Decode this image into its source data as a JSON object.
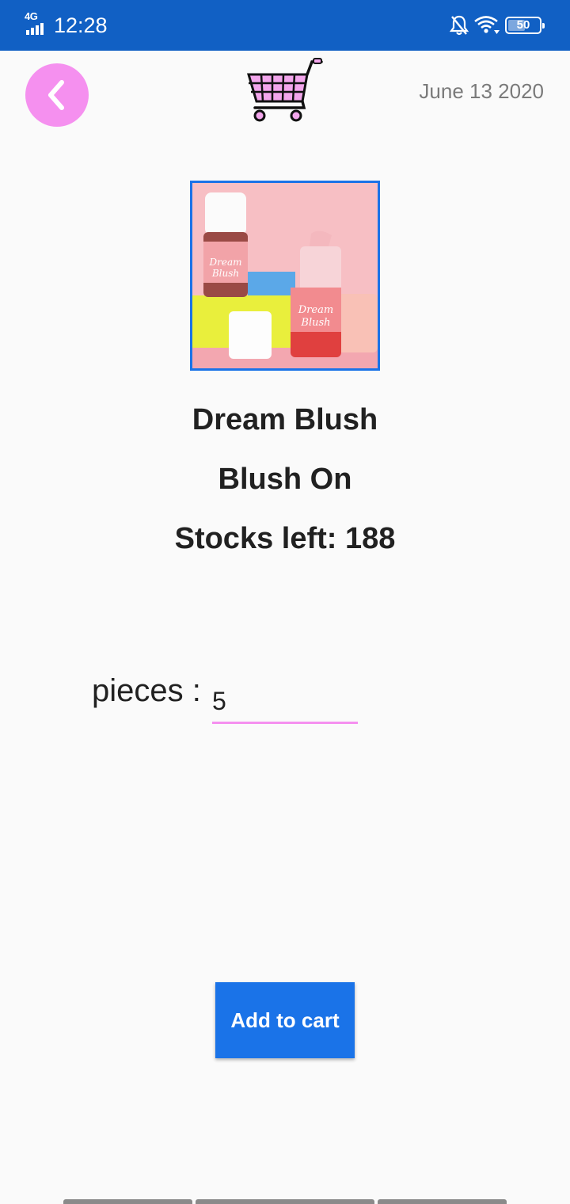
{
  "status_bar": {
    "network": "4G",
    "time": "12:28",
    "battery": "50"
  },
  "header": {
    "date": "June 13 2020",
    "back_icon": "chevron-left-icon",
    "logo_icon": "shopping-cart-icon"
  },
  "product": {
    "image_alt": "Dream Blush product photo",
    "name": "Dream Blush",
    "category": "Blush On",
    "stocks_text": "Stocks left: 188"
  },
  "order": {
    "pieces_label": "pieces :",
    "pieces_value": "5"
  },
  "actions": {
    "add_to_cart_label": "Add to cart"
  },
  "colors": {
    "status_bar": "#1160c4",
    "accent_pink": "#f590ef",
    "primary_blue": "#1a73e8"
  }
}
